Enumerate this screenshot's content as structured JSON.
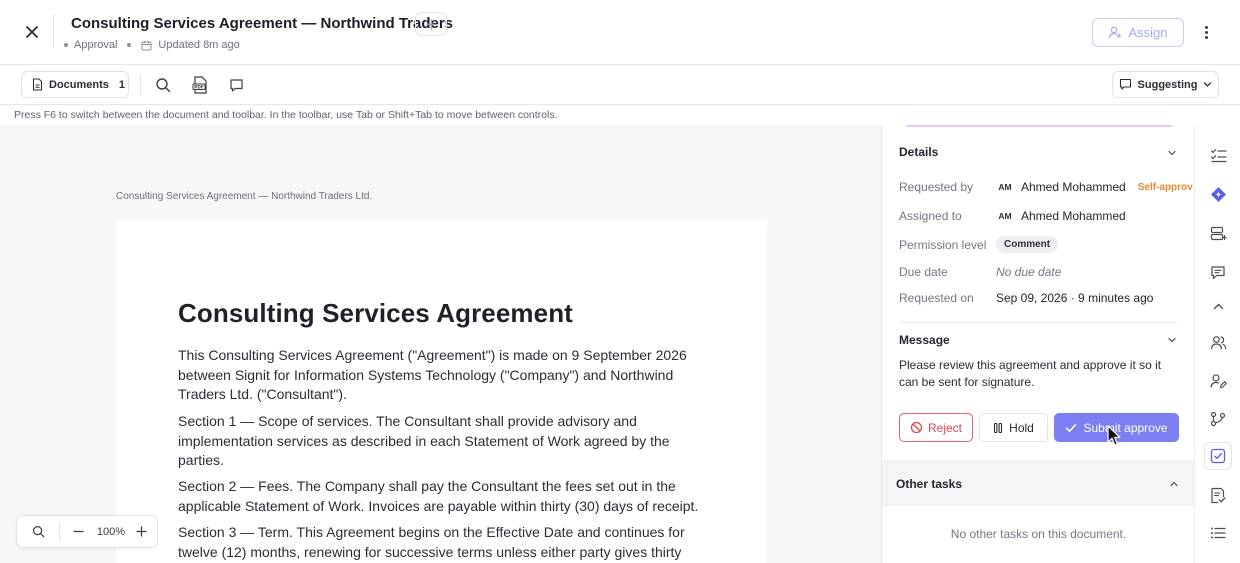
{
  "header": {
    "title": "Consulting Services Agreement — Northwind Traders",
    "type_label": "Approval",
    "updated": "Updated 8m ago",
    "assign_label": "Assign"
  },
  "toolbar": {
    "documents_label": "Documents",
    "documents_count": "1",
    "suggesting_label": "Suggesting"
  },
  "hint": "Press F6 to switch between the document and toolbar. In the toolbar, use Tab or Shift+Tab to move between controls.",
  "document": {
    "caption": "Consulting Services Agreement — Northwind Traders Ltd.",
    "heading": "Consulting Services Agreement",
    "paragraphs": [
      "This Consulting Services Agreement (\"Agreement\") is made on 9 September 2026 between Signit for Information Systems Technology (\"Company\") and Northwind Traders Ltd. (\"Consultant\").",
      "Section 1 — Scope of services. The Consultant shall provide advisory and implementation services as described in each Statement of Work agreed by the parties.",
      "Section 2 — Fees. The Company shall pay the Consultant the fees set out in the applicable Statement of Work. Invoices are payable within thirty (30) days of receipt.",
      "Section 3 — Term. This Agreement begins on the Effective Date and continues for twelve (12) months, renewing for successive terms unless either party gives thirty"
    ]
  },
  "zoom": {
    "level": "100%"
  },
  "details": {
    "title": "Details",
    "requested_by_label": "Requested by",
    "requested_by_initials": "AM",
    "requested_by_name": "Ahmed Mohammed",
    "requested_by_badge": "Self-approv",
    "assigned_to_label": "Assigned to",
    "assigned_to_initials": "AM",
    "assigned_to_name": "Ahmed Mohammed",
    "permission_label": "Permission level",
    "permission_value": "Comment",
    "due_label": "Due date",
    "due_value": "No due date",
    "requested_on_label": "Requested on",
    "requested_on_value": "Sep 09, 2026 · 9 minutes ago"
  },
  "message": {
    "title": "Message",
    "body": "Please review this agreement and approve it so it can be sent for signature."
  },
  "actions": {
    "reject": "Reject",
    "hold": "Hold",
    "approve": "Submit approve"
  },
  "other_tasks": {
    "title": "Other tasks",
    "empty": "No other tasks on this document."
  },
  "colors": {
    "accent": "#7c7ff1",
    "reject": "#d9474c",
    "self_approve": "#e88a2c",
    "rail_brand": "#5b5ef0"
  },
  "rail_icons": [
    "checklist-icon",
    "ai-diamond-icon",
    "fields-icon",
    "comments-icon",
    "collapse-up-icon",
    "recipients-icon",
    "signer-roles-icon",
    "workflow-icon",
    "approval-icon",
    "tasks-icon",
    "list-icon"
  ]
}
